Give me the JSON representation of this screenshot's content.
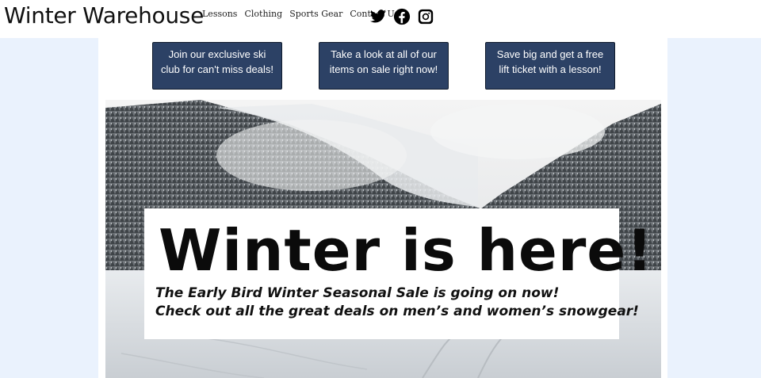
{
  "header": {
    "brand": "Winter Warehouse",
    "nav": [
      "Lessons",
      "Clothing",
      "Sports Gear",
      "Contact Us"
    ],
    "social": [
      "twitter-icon",
      "facebook-icon",
      "instagram-icon"
    ]
  },
  "promos": [
    {
      "text": "Join our exclusive ski club for can't miss deals!"
    },
    {
      "text": "Take a look at all of our items on sale right now!"
    },
    {
      "text": "Save big and get a free lift ticket with a lesson!"
    }
  ],
  "hero": {
    "title": "Winter is here!",
    "line1": "The Early Bird Winter Seasonal Sale is going on now!",
    "line2": "Check out all the great deals on men’s and women’s snowgear!"
  },
  "colors": {
    "page_background": "#eaf2fd",
    "promo_button": "#2c4165",
    "text": "#111111"
  }
}
